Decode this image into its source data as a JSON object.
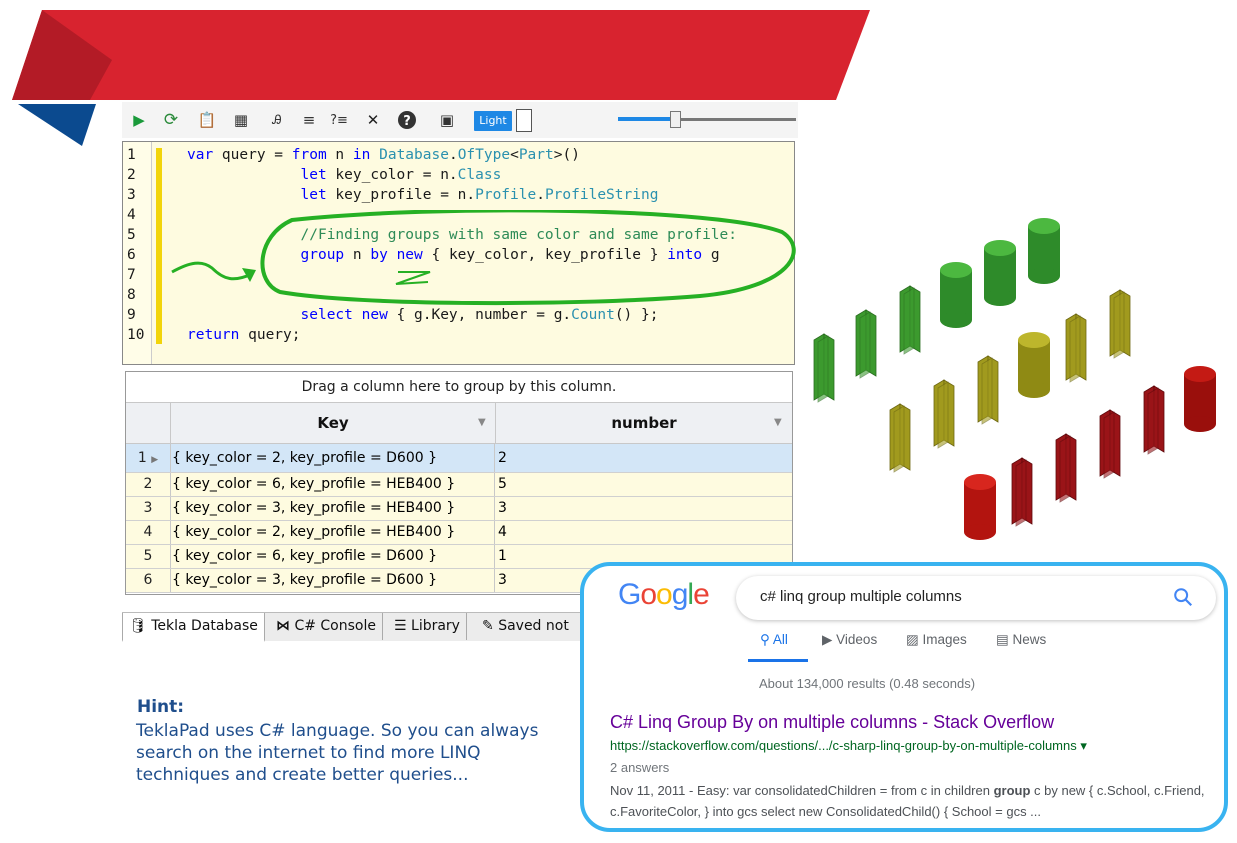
{
  "toolbar": {
    "icons": [
      "play-icon",
      "refresh-icon",
      "clipboard-icon",
      "table-icon",
      "search-text-icon",
      "list-icon",
      "question-list-icon",
      "cursor-icon",
      "help-icon",
      "screen-icon"
    ],
    "theme_button": "Light",
    "colors": {
      "accent": "#1e88e5"
    }
  },
  "editor": {
    "line_numbers": [
      "1",
      "2",
      "3",
      "4",
      "5",
      "6",
      "7",
      "8",
      "9",
      "10"
    ],
    "lines": [
      "var query = from n in Database.OfType<Part>()",
      "             let key_color = n.Class",
      "             let key_profile = n.Profile.ProfileString",
      "",
      "             //Finding groups with same color and same profile:",
      "             group n by new { key_color, key_profile } into g",
      "",
      "",
      "             select new { g.Key, number = g.Count() };",
      "return query;"
    ]
  },
  "grid": {
    "group_hint": "Drag a column here to group by this column.",
    "columns": [
      "Key",
      "number"
    ],
    "rows": [
      {
        "n": "1",
        "key": "{ key_color = 2, key_profile = D600 }",
        "number": "2",
        "selected": true
      },
      {
        "n": "2",
        "key": "{ key_color = 6, key_profile = HEB400 }",
        "number": "5"
      },
      {
        "n": "3",
        "key": "{ key_color = 3, key_profile = HEB400 }",
        "number": "3"
      },
      {
        "n": "4",
        "key": "{ key_color = 2, key_profile = HEB400 }",
        "number": "4"
      },
      {
        "n": "5",
        "key": "{ key_color = 6, key_profile = D600 }",
        "number": "1"
      },
      {
        "n": "6",
        "key": "{ key_color = 3, key_profile = D600 }",
        "number": "3"
      }
    ]
  },
  "tabs": [
    "Tekla Database",
    "C# Console",
    "Library",
    "Saved not"
  ],
  "hint": {
    "title": "Hint:",
    "text": "TeklaPad uses C# language. So you can always search on the internet to find more LINQ techniques and create better queries..."
  },
  "google": {
    "logo": "Google",
    "query": "c# linq group multiple columns",
    "tabs": [
      "All",
      "Videos",
      "Images",
      "News"
    ],
    "stats": "About 134,000 results (0.48 seconds)",
    "result_title": "C# Linq Group By on multiple columns - Stack Overflow",
    "result_url": "https://stackoverflow.com/questions/.../c-sharp-linq-group-by-on-multiple-columns",
    "result_url_arrow": "▾",
    "answers": "2 answers",
    "snippet_pre": "Nov 11, 2011 - Easy: var consolidatedChildren = from c in children ",
    "snippet_bold": "group",
    "snippet_post": " c by new { c.School, c.Friend, c.FavoriteColor, } into gcs select new ConsolidatedChild() { School = gcs ...",
    "colors": {
      "border": "#39b3f0",
      "link": "#660099",
      "url": "#006621"
    }
  },
  "banner_colors": {
    "red": "#d8232f",
    "dark_red": "#b01a24",
    "blue": "#0b4a8f"
  }
}
